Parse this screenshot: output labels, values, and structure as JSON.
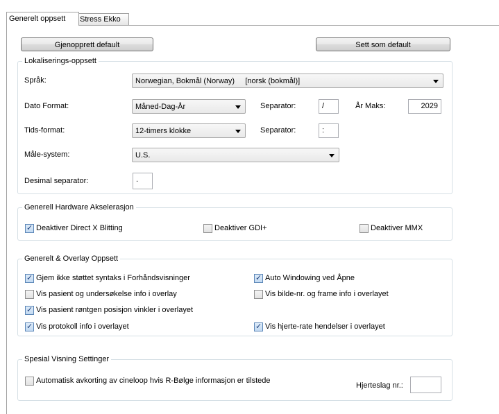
{
  "tabs": [
    {
      "label": "Generelt oppsett",
      "active": true
    },
    {
      "label": "Stress Ekko",
      "active": false
    }
  ],
  "buttons": {
    "restore_default": "Gjenopprett default",
    "set_default": "Sett som default"
  },
  "localization": {
    "title": "Lokaliserings-oppsett",
    "language_label": "Språk:",
    "language_value": "Norwegian, Bokmål (Norway)     [norsk (bokmål)]",
    "date_format_label": "Dato Format:",
    "date_format_value": "Måned-Dag-År",
    "date_separator_label": "Separator:",
    "date_separator_value": "/",
    "year_max_label": "År Maks:",
    "year_max_value": "2029",
    "time_format_label": "Tids-format:",
    "time_format_value": "12-timers klokke",
    "time_separator_label": "Separator:",
    "time_separator_value": ":",
    "measure_label": "Måle-system:",
    "measure_value": "U.S.",
    "decimal_label": "Desimal separator:",
    "decimal_value": "."
  },
  "hardware": {
    "title": "Generell Hardware Akselerasjon",
    "items": [
      {
        "label": "Deaktiver Direct X Blitting",
        "checked": true
      },
      {
        "label": "Deaktiver GDI+",
        "checked": false
      },
      {
        "label": "Deaktiver MMX",
        "checked": false
      }
    ]
  },
  "overlay": {
    "title": "Generelt & Overlay Oppsett",
    "items": [
      {
        "label": "Gjem ikke støttet syntaks i Forhåndsvisninger",
        "checked": true
      },
      {
        "label": "Auto Windowing ved Åpne",
        "checked": true
      },
      {
        "label": "Vis pasient og undersøkelse info i overlay",
        "checked": false
      },
      {
        "label": "Vis bilde-nr. og frame info i overlayet",
        "checked": false
      },
      {
        "label": "Vis pasient røntgen posisjon vinkler i overlayet",
        "checked": true
      },
      {
        "label": "Vis protokoll info i overlayet",
        "checked": true
      },
      {
        "label": "Vis hjerte-rate hendelser i overlayet",
        "checked": true
      }
    ]
  },
  "special": {
    "title": "Spesial Visning Settinger",
    "auto_trim_label": "Automatisk avkorting av cineloop hvis R-Bølge informasjon er tilstede",
    "auto_trim_checked": false,
    "heartbeat_label": "Hjerteslag nr.:",
    "heartbeat_value": ""
  },
  "colors": {
    "group_border": "#d5dfe5",
    "check_mark": "#1e3f7a"
  }
}
